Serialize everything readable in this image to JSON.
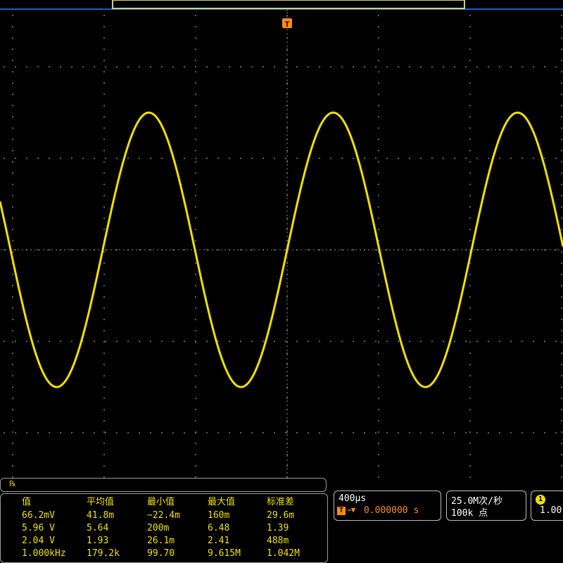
{
  "colors": {
    "trace": "#f0e000",
    "grid": "#5a5a5a",
    "trigger": "#ff8c1a",
    "record_bar": "#2060c0",
    "panel_border": "#9a9a9a"
  },
  "trigger_marker": {
    "label": "T"
  },
  "waveform": {
    "channel": "1",
    "frequency_text": "1.000kHz",
    "cycles_visible": 3.1
  },
  "measurement_badge": "℞",
  "measurements": {
    "headers": [
      "值",
      "平均值",
      "最小值",
      "最大值",
      "标准差"
    ],
    "rows": [
      [
        "66.2mV",
        "41.8m",
        "−22.4m",
        "160m",
        "29.6m"
      ],
      [
        "5.96 V",
        "5.64",
        "200m",
        "6.48",
        "1.39"
      ],
      [
        "2.04 V",
        "1.93",
        "26.1m",
        "2.41",
        "488m"
      ],
      [
        "1.000kHz",
        "179.2k",
        "99.70",
        "9.615M",
        "1.042M"
      ]
    ]
  },
  "horizontal": {
    "scale": "400µs",
    "position_icon": "T→▼",
    "position": "0.000000 s"
  },
  "acquisition": {
    "sample_rate": "25.0M次/秒",
    "record_length": "100k 点"
  },
  "channel_panel": {
    "badge": "1",
    "value": "1.00"
  }
}
